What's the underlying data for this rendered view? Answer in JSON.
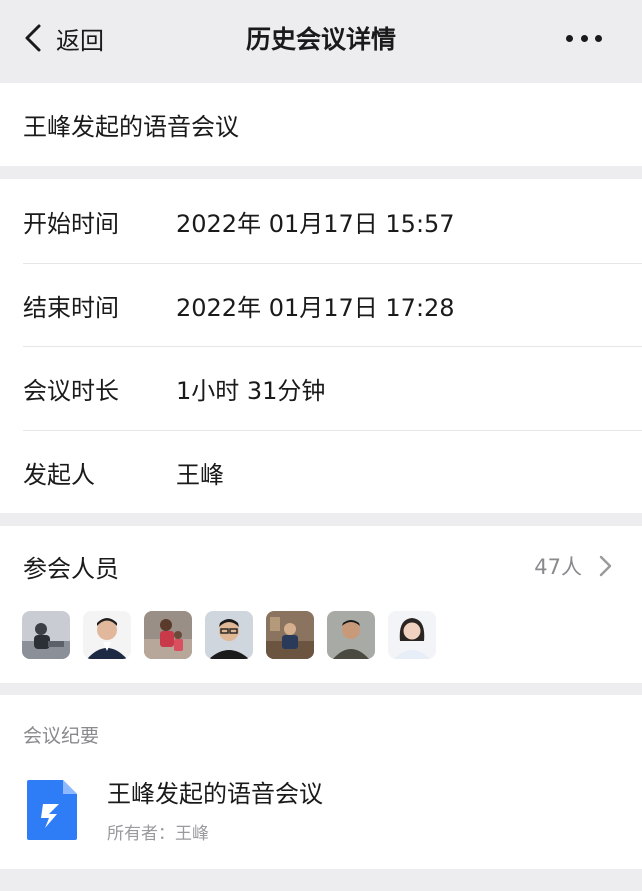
{
  "navbar": {
    "back_label": "返回",
    "title": "历史会议详情",
    "more_icon": "more-horizontal-icon"
  },
  "meeting": {
    "name": "王峰发起的语音会议"
  },
  "info": {
    "start_label": "开始时间",
    "start_value": "2022年 01月17日  15:57",
    "end_label": "结束时间",
    "end_value": "2022年 01月17日  17:28",
    "duration_label": "会议时长",
    "duration_value": "1小时 31分钟",
    "host_label": "发起人",
    "host_value": "王峰"
  },
  "participants": {
    "label": "参会人员",
    "count": "47人",
    "avatars": [
      {
        "name": "participant-1"
      },
      {
        "name": "participant-2"
      },
      {
        "name": "participant-3"
      },
      {
        "name": "participant-4"
      },
      {
        "name": "participant-5"
      },
      {
        "name": "participant-6"
      },
      {
        "name": "participant-7"
      }
    ]
  },
  "notes": {
    "label": "会议纪要",
    "doc_title": "王峰发起的语音会议",
    "doc_owner": "所有者：王峰",
    "doc_icon": "dingtalk-doc-icon",
    "accent": "#2f7df6"
  }
}
